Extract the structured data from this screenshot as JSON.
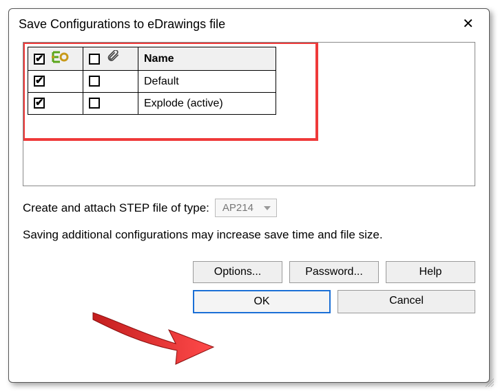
{
  "dialog": {
    "title": "Save Configurations to eDrawings file"
  },
  "table": {
    "header_name": "Name",
    "rows": [
      {
        "checked": true,
        "attach": false,
        "name": "Default"
      },
      {
        "checked": true,
        "attach": false,
        "name": "Explode (active)"
      }
    ],
    "header_checked": true,
    "header_attach": false
  },
  "step": {
    "label": "Create and attach STEP file of type:",
    "value": "AP214"
  },
  "warning": "Saving additional configurations may increase save time and file size.",
  "buttons": {
    "options": "Options...",
    "password": "Password...",
    "help": "Help",
    "ok": "OK",
    "cancel": "Cancel"
  }
}
